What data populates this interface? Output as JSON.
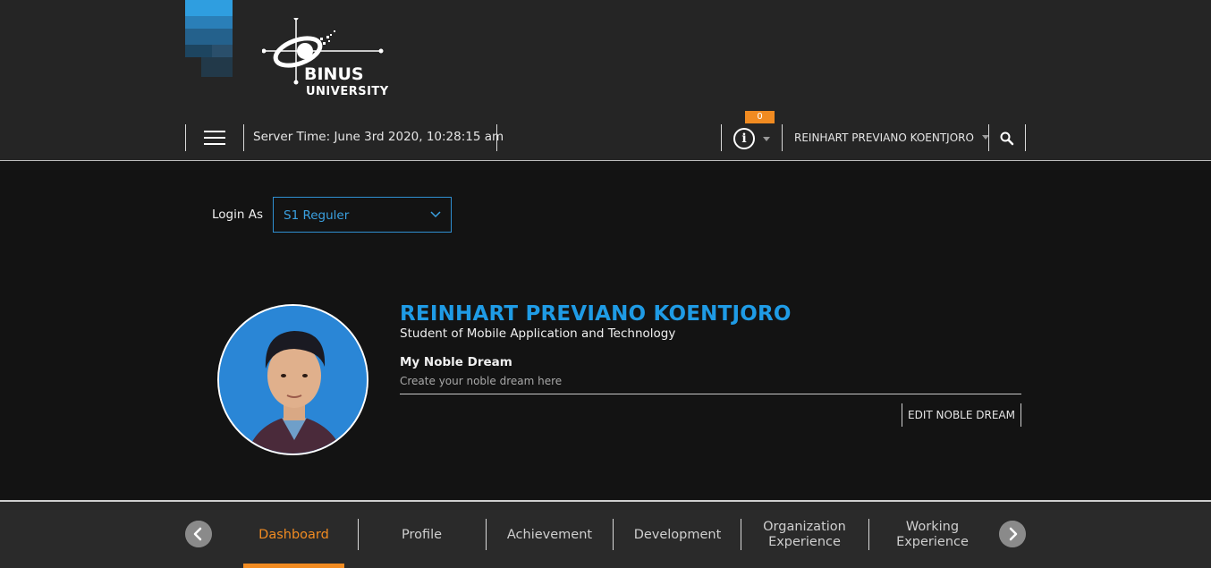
{
  "header": {
    "logo_line1": "BINUS",
    "logo_line2": "UNIVERSITY",
    "server_time": "Server Time: June 3rd 2020, 10:28:15 am",
    "notification_count": "0",
    "user_name": "REINHART PREVIANO KOENTJORO",
    "menu_icon": "hamburger-icon",
    "info_icon": "info-icon",
    "search_icon": "search-icon",
    "accent_color": "#f18b21",
    "brand_color": "#1f9be5"
  },
  "login": {
    "label": "Login As",
    "selected": "S1 Reguler"
  },
  "profile": {
    "name": "REINHART PREVIANO KOENTJORO",
    "role": "Student of Mobile Application and Technology",
    "dream_title": "My Noble Dream",
    "dream_placeholder": "Create your noble dream here",
    "edit_button": "EDIT NOBLE DREAM"
  },
  "nav": {
    "tabs": [
      {
        "label": "Dashboard",
        "active": true
      },
      {
        "label": "Profile",
        "active": false
      },
      {
        "label": "Achievement",
        "active": false
      },
      {
        "label": "Development",
        "active": false
      },
      {
        "label": "Organization Experience",
        "active": false
      },
      {
        "label": "Working Experience",
        "active": false
      }
    ],
    "prev_icon": "chevron-left-icon",
    "next_icon": "chevron-right-icon"
  }
}
